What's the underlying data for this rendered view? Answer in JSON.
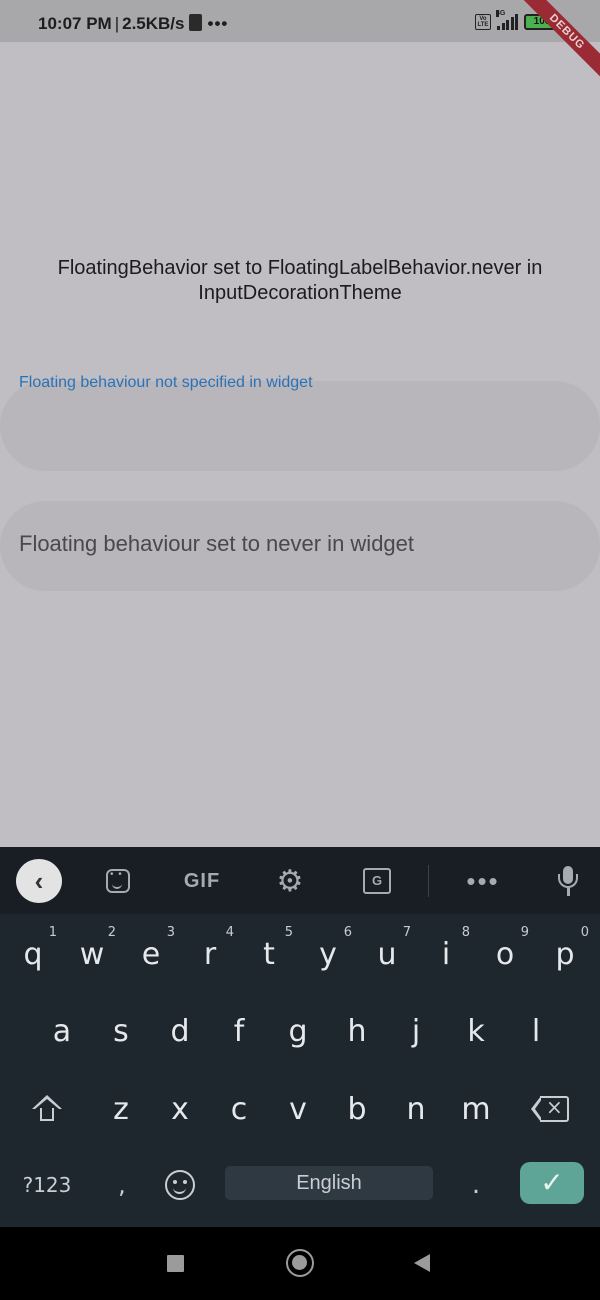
{
  "status_bar": {
    "time": "10:07 PM",
    "separator": "|",
    "net_speed": "2.5KB/s",
    "more_dots": "•••",
    "volte_label": "Vo LTE",
    "network_type": "4G",
    "battery": "100",
    "battery_color": "#4caf50"
  },
  "debug_banner": "DEBUG",
  "content": {
    "heading": "FloatingBehavior set to FloatingLabelBehavior.never in InputDecorationTheme",
    "field1_label": "Floating behaviour not specified in widget",
    "field2_label": "Floating behaviour set to never in widget",
    "accent_color": "#2a72b8"
  },
  "keyboard": {
    "toolbar": {
      "gif_label": "GIF",
      "translate_label": "G",
      "more_label": "•••",
      "back_label": "‹"
    },
    "row1": [
      {
        "key": "q",
        "hint": "1"
      },
      {
        "key": "w",
        "hint": "2"
      },
      {
        "key": "e",
        "hint": "3"
      },
      {
        "key": "r",
        "hint": "4"
      },
      {
        "key": "t",
        "hint": "5"
      },
      {
        "key": "y",
        "hint": "6"
      },
      {
        "key": "u",
        "hint": "7"
      },
      {
        "key": "i",
        "hint": "8"
      },
      {
        "key": "o",
        "hint": "9"
      },
      {
        "key": "p",
        "hint": "0"
      }
    ],
    "row2": [
      "a",
      "s",
      "d",
      "f",
      "g",
      "h",
      "j",
      "k",
      "l"
    ],
    "row3": [
      "z",
      "x",
      "c",
      "v",
      "b",
      "n",
      "m"
    ],
    "symbols_key": "?123",
    "comma_key": ",",
    "space_label": "English",
    "period_key": ".",
    "enter_label": "✓",
    "enter_color": "#5fa597"
  }
}
